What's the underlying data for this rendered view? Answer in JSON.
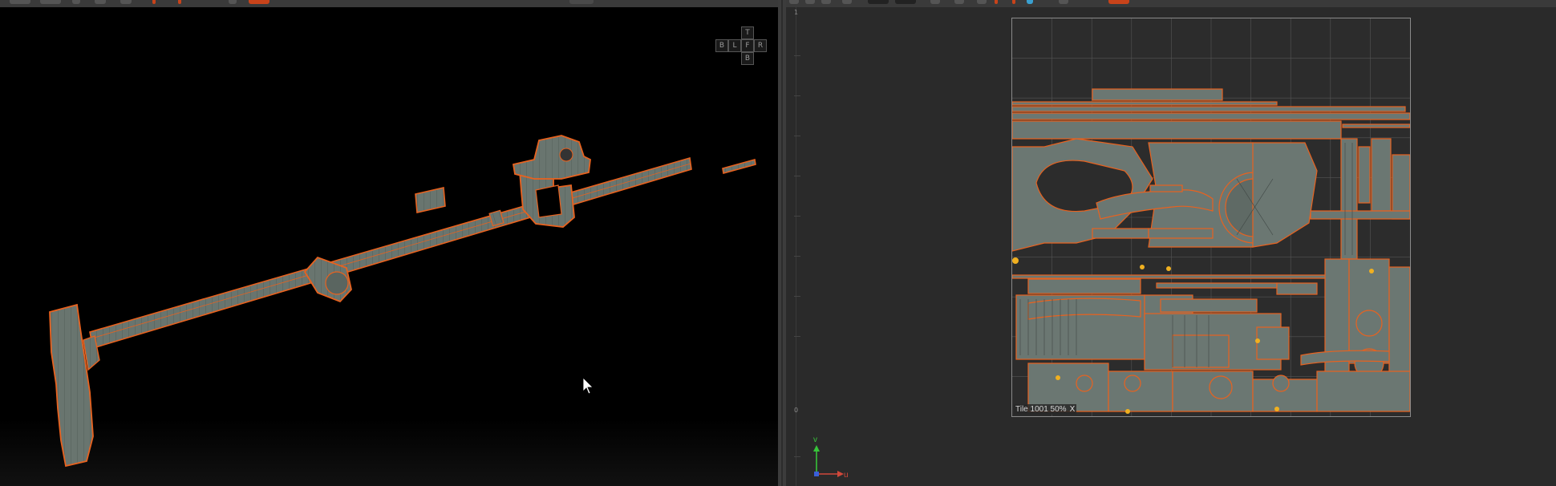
{
  "viewport": {
    "view_cube": {
      "top": "T",
      "left_b": "B",
      "left": "L",
      "front": "F",
      "right": "R",
      "bottom": "B"
    }
  },
  "uv_editor": {
    "ruler": {
      "top_label": "1",
      "bottom_label": "0"
    },
    "tile_label": {
      "text": "Tile 1001 50%",
      "close": "X"
    },
    "axis": {
      "v_label": "v",
      "u_label": "u"
    }
  },
  "colors": {
    "wire_orange": "#e8621f",
    "mesh_gray": "#6b7772",
    "viewport_bg": "#000000",
    "panel_bg": "#2a2a2a",
    "axis_v": "#37c43a",
    "axis_u": "#d0483a",
    "axis_origin": "#3a5fd8"
  },
  "icons": [
    "cursor-arrow-icon",
    "close-icon"
  ]
}
